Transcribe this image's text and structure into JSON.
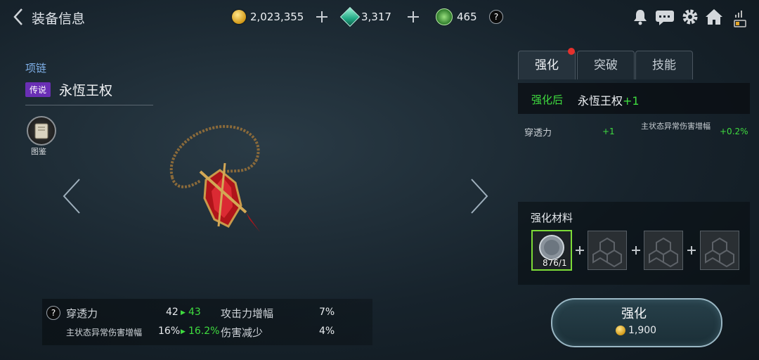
{
  "header": {
    "title": "装备信息",
    "currencies": [
      {
        "icon": "gold-coin-icon",
        "value": "2,023,355"
      },
      {
        "icon": "green-gem-icon",
        "value": "3,317"
      },
      {
        "icon": "green-crystal-icon",
        "value": "465"
      }
    ],
    "help_label": "?"
  },
  "item": {
    "category": "项链",
    "rarity": "传说",
    "name": "永恆王权",
    "codex_label": "图鉴"
  },
  "stats": {
    "help_label": "?",
    "rows": [
      {
        "label": "穿透力",
        "from": "42",
        "to": "43"
      },
      {
        "label": "主状态异常伤害增幅",
        "from": "16%",
        "to": "16.2%"
      }
    ],
    "right": [
      {
        "label": "攻击力增幅",
        "value": "7%"
      },
      {
        "label": "伤害减少",
        "value": "4%"
      }
    ]
  },
  "tabs": [
    "强化",
    "突破",
    "技能"
  ],
  "enhance": {
    "after_label": "强化后",
    "item_name": "永恆王权",
    "level_suffix": "+1",
    "bonuses": [
      {
        "label": "穿透力",
        "value": "+1"
      },
      {
        "label": "主状态异常伤害增幅",
        "value": "+0.2%"
      }
    ],
    "materials_title": "强化材料",
    "material_count": "876/1",
    "button_label": "强化",
    "cost": "1,900"
  },
  "colors": {
    "accent_green": "#3fdc3f",
    "rarity_legendary": "#6a2fb5",
    "category_blue": "#7fb0e8",
    "notification_red": "#e5312d"
  }
}
